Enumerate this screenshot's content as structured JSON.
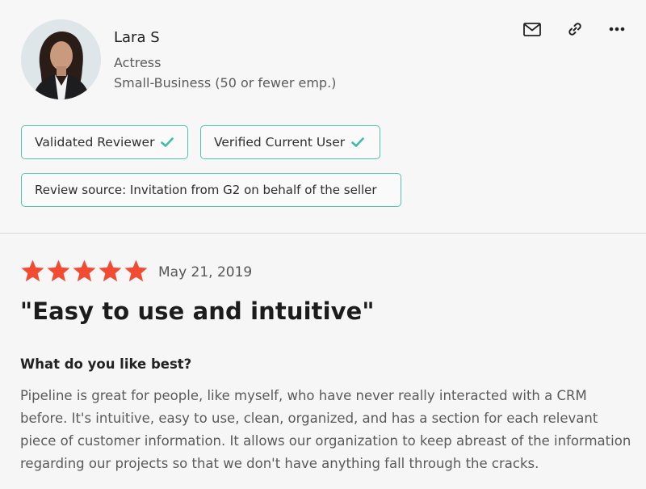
{
  "reviewer": {
    "name": "Lara S",
    "role": "Actress",
    "company_size": "Small-Business (50 or fewer emp.)"
  },
  "actions": {
    "icons": [
      "mail-icon",
      "link-icon",
      "more-icon"
    ]
  },
  "badges": {
    "validated": "Validated Reviewer",
    "verified": "Verified Current User",
    "source": "Review source: Invitation from G2 on behalf of the seller"
  },
  "review": {
    "rating": 5,
    "max_rating": 5,
    "date": "May 21, 2019",
    "title": "\"Easy to use and intuitive\"",
    "question": "What do you like best?",
    "answer": "Pipeline is great for people, like myself, who have never really interacted with a CRM before. It's intuitive, easy to use, clean, organized, and has a section for each relevant piece of customer information. It allows our organization to keep abreast of the information regarding our projects so that we don't have anything fall through the cracks."
  },
  "colors": {
    "star": "#f24a33",
    "badge_border": "#4fc3b0",
    "check": "#3fbba6"
  }
}
